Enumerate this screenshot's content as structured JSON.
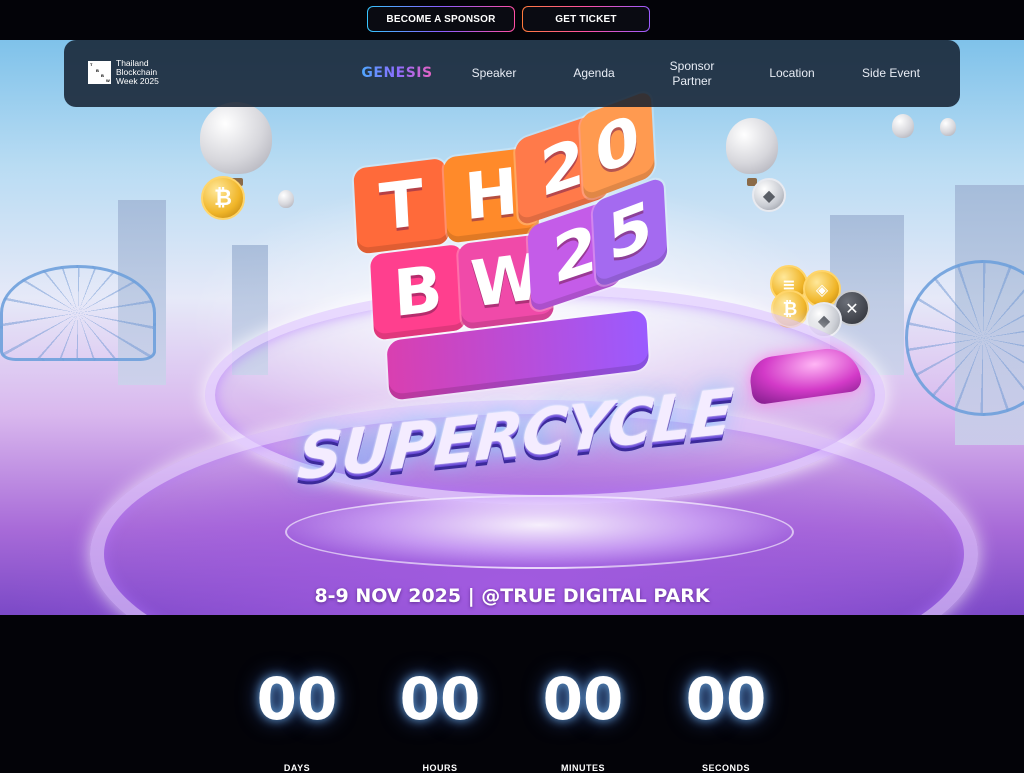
{
  "header": {
    "become_sponsor": "BECOME A SPONSOR",
    "get_ticket": "GET TICKET"
  },
  "nav": {
    "brand_lines": [
      "Thailand",
      "Blockchain",
      "Week 2025"
    ],
    "brand_mark_letters": [
      "T",
      "B",
      "B",
      "W"
    ],
    "genesis": "GENESIS",
    "items": [
      "Speaker",
      "Agenda",
      "Sponsor Partner",
      "Location",
      "Side Event"
    ],
    "sponsor_line1": "Sponsor",
    "sponsor_line2": "Partner"
  },
  "hero": {
    "cube_cells": [
      "T",
      "H",
      "2",
      "0",
      "B",
      "W",
      "2",
      "5"
    ],
    "tagline": "SUPERCYCLE",
    "dates": "8-9 NOV 2025 | @TRUE DIGITAL PARK",
    "partner_logo": "cryptomind",
    "cube_colors": [
      "#ff6a3a",
      "#ff8a2a",
      "#ff7a4a",
      "#ff9a50",
      "#ff3f8e",
      "#f04aa9",
      "#c45ce8",
      "#a46af0"
    ]
  },
  "countdown": {
    "days": "00",
    "hours": "00",
    "minutes": "00",
    "seconds": "00",
    "days_label": "DAYS",
    "hours_label": "HOURS",
    "minutes_label": "MINUTES",
    "seconds_label": "SECONDS"
  },
  "colors": {
    "background": "#030308",
    "nav_bg": "#142030",
    "accent_blue": "#3fb7ff",
    "accent_pink": "#ff5fb1"
  }
}
